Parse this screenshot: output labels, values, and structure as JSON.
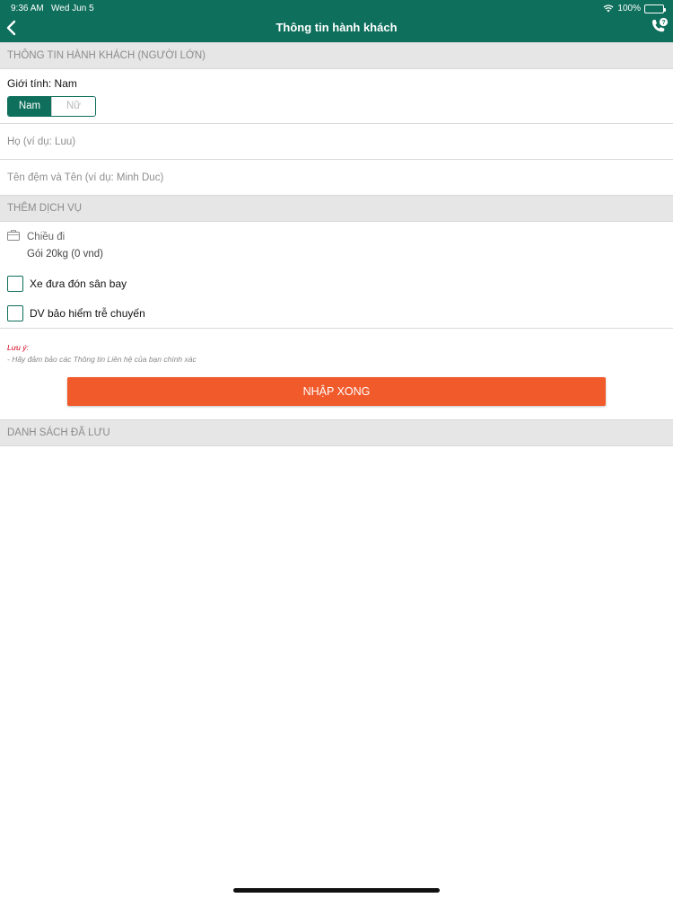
{
  "colors": {
    "primary": "#0e6f5c",
    "accent": "#f15a2b",
    "note": "#d0021b",
    "section_bg": "#e6e6e6"
  },
  "status_bar": {
    "time": "9:36 AM",
    "date": "Wed Jun 5",
    "battery": "100%",
    "battery_level": 1.0,
    "wifi_icon": "wifi-icon"
  },
  "nav": {
    "title": "Thông tin hành khách",
    "back_icon": "chevron-left-icon",
    "support_icon": "phone-support-icon"
  },
  "passenger": {
    "section_title": "THÔNG TIN HÀNH KHÁCH (NGƯỜI LỚN)",
    "gender_label": "Giới tính: Nam",
    "gender_options": [
      "Nam",
      "Nữ"
    ],
    "gender_selected": "Nam",
    "last_name_placeholder": "Họ (ví dụ: Luu)",
    "first_name_placeholder": "Tên đệm và Tên (ví dụ: Minh Duc)"
  },
  "services": {
    "section_title": "THÊM DỊCH VỤ",
    "baggage_direction": "Chiều đi",
    "baggage_package": "Gói 20kg (0 vnd)",
    "options": [
      {
        "label": "Xe đưa đón sân bay",
        "checked": false
      },
      {
        "label": "DV bảo hiểm trễ chuyến",
        "checked": false
      }
    ]
  },
  "note": {
    "title": "Lưu ý:",
    "text": "- Hãy đảm bảo các Thông tin Liên hệ của bạn chính xác"
  },
  "submit_label": "NHẬP XONG",
  "saved_list": {
    "section_title": "DANH SÁCH ĐÃ LƯU"
  }
}
